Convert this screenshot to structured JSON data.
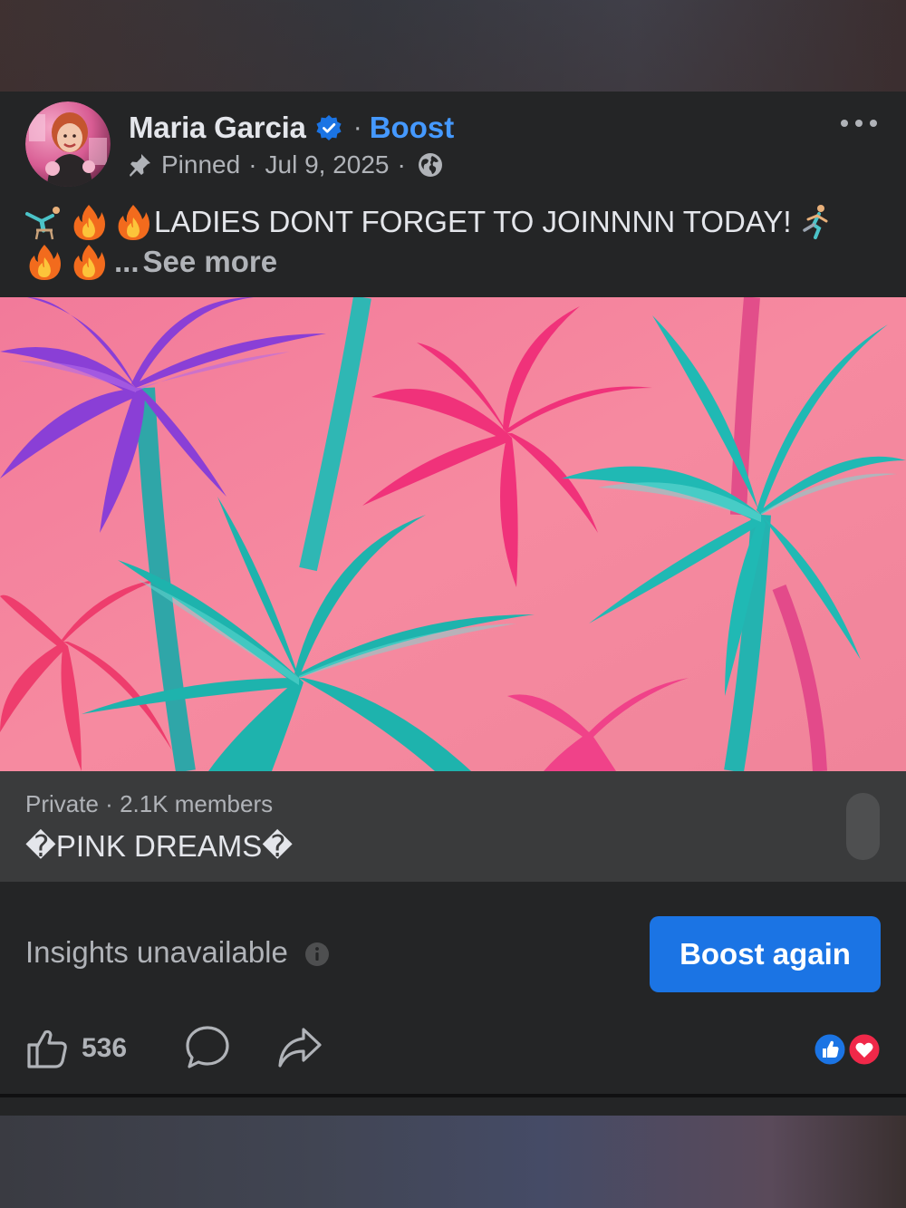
{
  "post": {
    "author_name": "Maria Garcia",
    "separator": "·",
    "boost_link": "Boost",
    "pinned_label": "Pinned",
    "date": "Jul 9, 2025",
    "text_line1": "LADIES DONT FORGET TO JOINNNN TODAY!",
    "text_line2_prefix": "...",
    "see_more": "See more",
    "icons": {
      "verified": "verified-badge-icon",
      "pin": "pin-icon",
      "audience": "globe-icon",
      "more": "more-options-icon"
    }
  },
  "group": {
    "privacy": "Private",
    "separator": "·",
    "members": "2.1K members",
    "name": "�PINK DREAMS�"
  },
  "insights": {
    "label": "Insights unavailable",
    "boost_again_label": "Boost again"
  },
  "actions": {
    "like_count": "536",
    "reactions": [
      "like",
      "love"
    ]
  },
  "colors": {
    "card_bg": "#242526",
    "accent": "#1b74e4",
    "link_blue": "#4599ff",
    "text_primary": "#e4e6eb",
    "text_secondary": "#b0b3b8"
  }
}
